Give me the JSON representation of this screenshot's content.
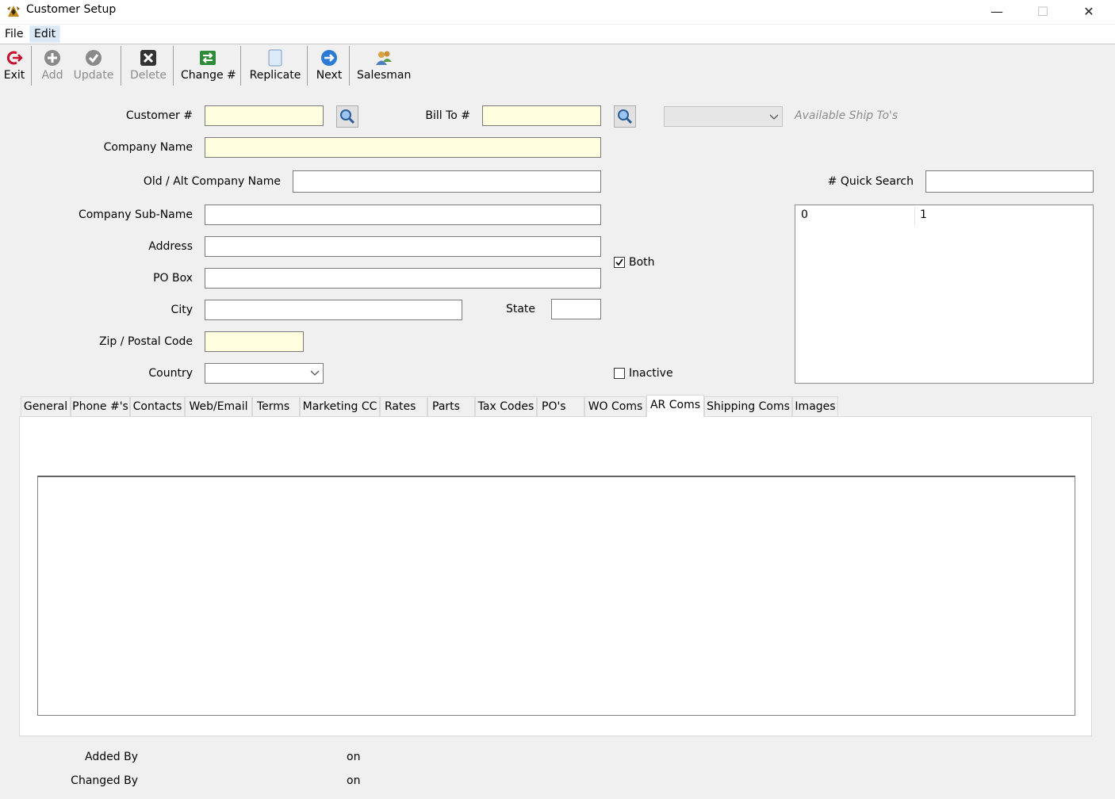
{
  "window": {
    "title": "Customer Setup",
    "minimize": "—",
    "maximize": "☐",
    "close": "✕"
  },
  "menu": {
    "file": "File",
    "edit": "Edit"
  },
  "toolbar": {
    "exit": "Exit",
    "add": "Add",
    "update": "Update",
    "delete": "Delete",
    "change": "Change #",
    "replicate": "Replicate",
    "next": "Next",
    "salesman": "Salesman"
  },
  "form": {
    "customer_label": "Customer #",
    "bill_to_label": "Bill To #",
    "ship_to_placeholder": "Available Ship To's",
    "company_name_label": "Company Name",
    "old_alt_label": "Old / Alt Company Name",
    "sub_name_label": "Company Sub-Name",
    "address_label": "Address",
    "po_box_label": "PO Box",
    "city_label": "City",
    "state_label": "State",
    "zip_label": "Zip / Postal Code",
    "country_label": "Country",
    "both_label": "Both",
    "both_checked": true,
    "inactive_label": "Inactive",
    "inactive_checked": false,
    "quick_search_label": "# Quick Search"
  },
  "list": {
    "col0": "0",
    "col1": "1"
  },
  "tabs": [
    "General",
    "Phone #'s",
    "Contacts",
    "Web/Email",
    "Terms",
    "Marketing CC",
    "Rates",
    "Parts",
    "Tax Codes",
    "PO's",
    "WO Coms",
    "AR Coms",
    "Shipping Coms",
    "Images"
  ],
  "selected_tab": "AR Coms",
  "footer": {
    "added_by": "Added By",
    "changed_by": "Changed By",
    "on1": "on",
    "on2": "on"
  }
}
